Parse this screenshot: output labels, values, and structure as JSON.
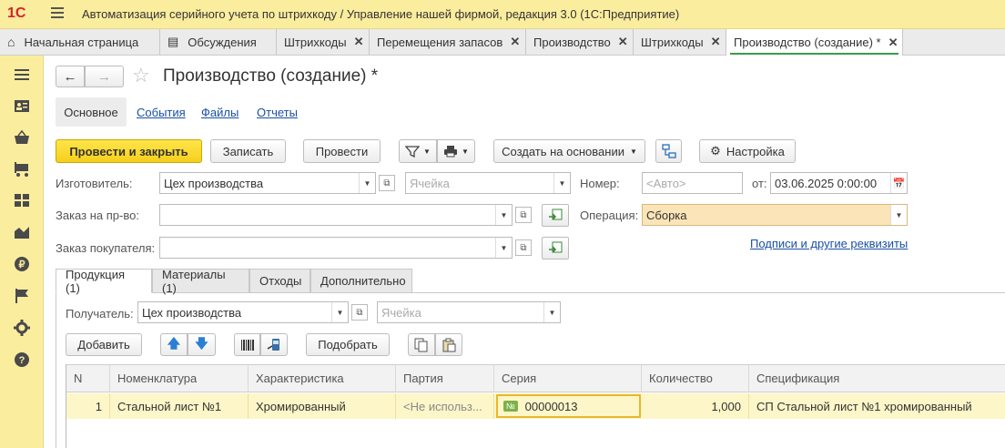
{
  "window": {
    "logo": "1С",
    "title": "Автоматизация серийного учета по штрихкоду / Управление нашей фирмой, редакция 3.0  (1С:Предприятие)"
  },
  "tabs": [
    {
      "label": "Начальная страница",
      "closable": false
    },
    {
      "label": "Обсуждения",
      "closable": false
    },
    {
      "label": "Штрихкоды",
      "closable": true
    },
    {
      "label": "Перемещения запасов",
      "closable": true
    },
    {
      "label": "Производство",
      "closable": true
    },
    {
      "label": "Штрихкоды",
      "closable": true
    },
    {
      "label": "Производство (создание) *",
      "closable": true,
      "active": true
    }
  ],
  "sidebar": {
    "icons": [
      "menu-icon",
      "contacts-icon",
      "basket-icon",
      "cart-icon",
      "grid-icon",
      "chart-icon",
      "ruble-icon",
      "flag-icon",
      "settings-icon",
      "help-icon"
    ]
  },
  "form": {
    "title": "Производство (создание) *",
    "sections": [
      "Основное",
      "События",
      "Файлы",
      "Отчеты"
    ],
    "toolbar": {
      "post_close": "Провести и закрыть",
      "save": "Записать",
      "post": "Провести",
      "create_based": "Создать на основании",
      "settings": "Настройка"
    },
    "fields": {
      "manufacturer_label": "Изготовитель:",
      "manufacturer_value": "Цех производства",
      "cell_placeholder": "Ячейка",
      "number_label": "Номер:",
      "number_placeholder": "<Авто>",
      "date_label": "от:",
      "date_value": "03.06.2025  0:00:00",
      "production_order_label": "Заказ на пр-во:",
      "operation_label": "Операция:",
      "operation_value": "Сборка",
      "customer_order_label": "Заказ покупателя:",
      "signatures_link": "Подписи и другие реквизиты"
    },
    "inner_tabs": [
      "Продукция (1)",
      "Материалы (1)",
      "Отходы",
      "Дополнительно"
    ],
    "products": {
      "receiver_label": "Получатель:",
      "receiver_value": "Цех производства",
      "cell_placeholder": "Ячейка",
      "add_button": "Добавить",
      "pick_button": "Подобрать",
      "columns": [
        "N",
        "Номенклатура",
        "Характеристика",
        "Партия",
        "Серия",
        "Количество",
        "Спецификация"
      ],
      "rows": [
        {
          "n": "1",
          "item": "Стальной лист №1",
          "characteristic": "Хромированный",
          "batch": "<Не использ...",
          "series_badge": "№",
          "series": "00000013",
          "quantity": "1,000",
          "spec": "СП Стальной лист №1 хромированный"
        }
      ]
    }
  },
  "colors": {
    "accent_yellow": "#fbed9e",
    "primary_button": "#f6cf1b",
    "active_tab_underline": "#3a9a4a",
    "selected_row": "#fdf6c8",
    "highlight_field": "#fbe5b8"
  }
}
